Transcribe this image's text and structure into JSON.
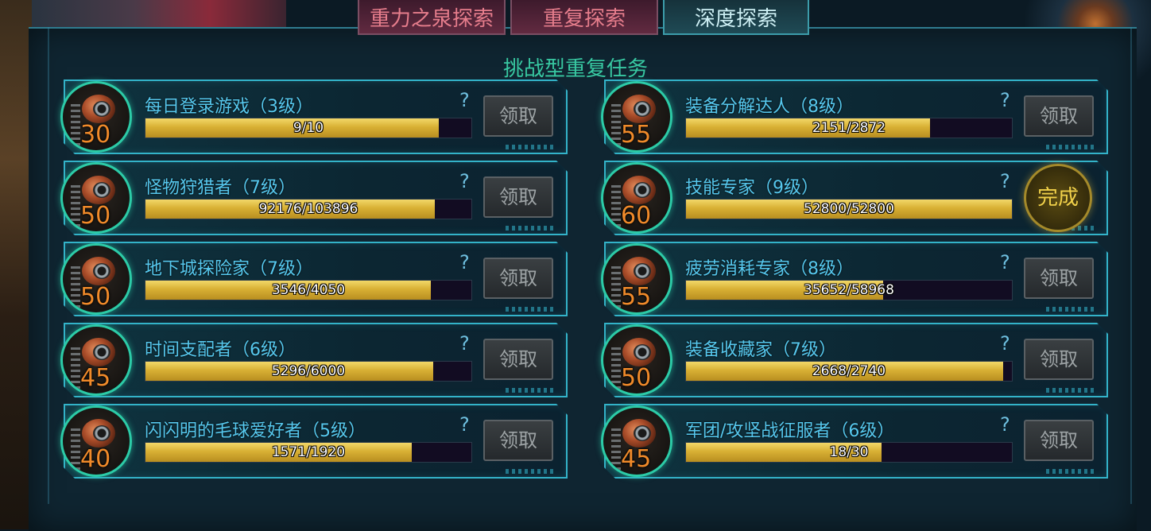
{
  "tabs": [
    {
      "label": "重力之泉探索",
      "active": false
    },
    {
      "label": "重复探索",
      "active": false
    },
    {
      "label": "深度探索",
      "active": true
    }
  ],
  "section_title": "挑战型重复任务",
  "help_symbol": "?",
  "claim_label": "领取",
  "done_label": "完成",
  "colors": {
    "accent": "#33b3c9",
    "bar_fill": "#d8b034",
    "reward_number": "#f08a2a",
    "task_name": "#56c8ee"
  },
  "tasks": [
    {
      "name": "每日登录游戏（3级）",
      "reward": "30",
      "progress_text": "9/10",
      "progress": 0.9,
      "status": "claim"
    },
    {
      "name": "装备分解达人（8级）",
      "reward": "55",
      "progress_text": "2151/2872",
      "progress": 0.749,
      "status": "claim"
    },
    {
      "name": "怪物狩猎者（7级）",
      "reward": "50",
      "progress_text": "92176/103896",
      "progress": 0.887,
      "status": "claim"
    },
    {
      "name": "技能专家（9级）",
      "reward": "60",
      "progress_text": "52800/52800",
      "progress": 1.0,
      "status": "done"
    },
    {
      "name": "地下城探险家（7级）",
      "reward": "50",
      "progress_text": "3546/4050",
      "progress": 0.876,
      "status": "claim"
    },
    {
      "name": "疲劳消耗专家（8级）",
      "reward": "55",
      "progress_text": "35652/58968",
      "progress": 0.605,
      "status": "claim"
    },
    {
      "name": "时间支配者（6级）",
      "reward": "45",
      "progress_text": "5296/6000",
      "progress": 0.883,
      "status": "claim"
    },
    {
      "name": "装备收藏家（7级）",
      "reward": "50",
      "progress_text": "2668/2740",
      "progress": 0.974,
      "status": "claim"
    },
    {
      "name": "闪闪明的毛球爱好者（5级）",
      "reward": "40",
      "progress_text": "1571/1920",
      "progress": 0.818,
      "status": "claim"
    },
    {
      "name": "军团/攻坚战征服者（6级）",
      "reward": "45",
      "progress_text": "18/30",
      "progress": 0.6,
      "status": "claim"
    }
  ]
}
